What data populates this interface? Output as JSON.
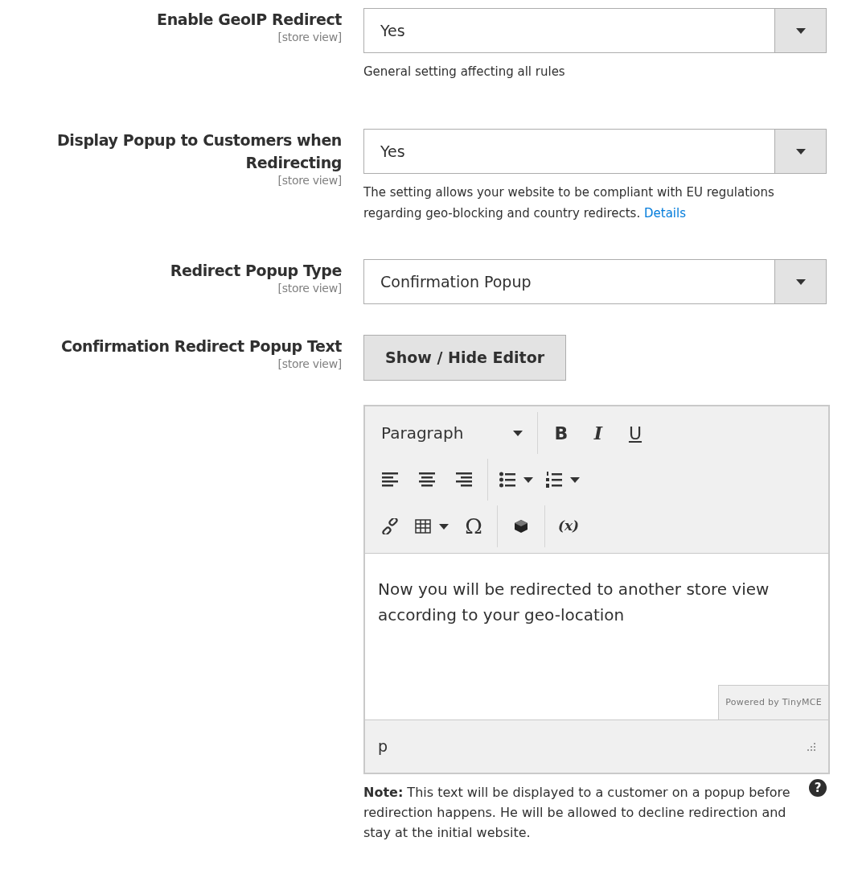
{
  "fields": [
    {
      "kind": "select",
      "label": "Enable GeoIP Redirect",
      "scope": "[store view]",
      "value": "Yes",
      "note": "General setting affecting all rules"
    },
    {
      "kind": "select",
      "label": "Display Popup to Customers when Redirecting",
      "scope": "[store view]",
      "value": "Yes",
      "note": "The setting allows your website to be compliant with EU regulations regarding geo-blocking and country redirects.",
      "link": "Details"
    },
    {
      "kind": "select",
      "label": "Redirect Popup Type",
      "scope": "[store view]",
      "value": "Confirmation Popup"
    },
    {
      "kind": "editor",
      "label": "Confirmation Redirect Popup Text",
      "scope": "[store view]",
      "button": "Show / Hide Editor",
      "toolbar": [
        [
          {
            "kind": "format",
            "label": "Paragraph"
          },
          {
            "kind": "bold",
            "label": "B"
          },
          {
            "kind": "italic",
            "label": "I"
          },
          {
            "kind": "underline",
            "label": "U"
          }
        ],
        [
          {
            "kind": "alignleft"
          },
          {
            "kind": "aligncenter"
          },
          {
            "kind": "alignright"
          },
          {
            "kind": "bullets"
          },
          {
            "kind": "numbers"
          }
        ],
        [
          {
            "kind": "link"
          },
          {
            "kind": "table"
          },
          {
            "kind": "symbol",
            "label": "Ω"
          },
          {
            "kind": "widget"
          },
          {
            "kind": "variable",
            "label": "(x)"
          }
        ]
      ],
      "content": "Now you will be redirected to another store view according to your geo-location",
      "branding": "Powered by TinyMCE",
      "path": "p",
      "help": "?",
      "note": "**Note:** This text will be displayed to a customer on a popup before redirection happens. He will be allowed to decline redirection and stay at the initial website."
    }
  ]
}
